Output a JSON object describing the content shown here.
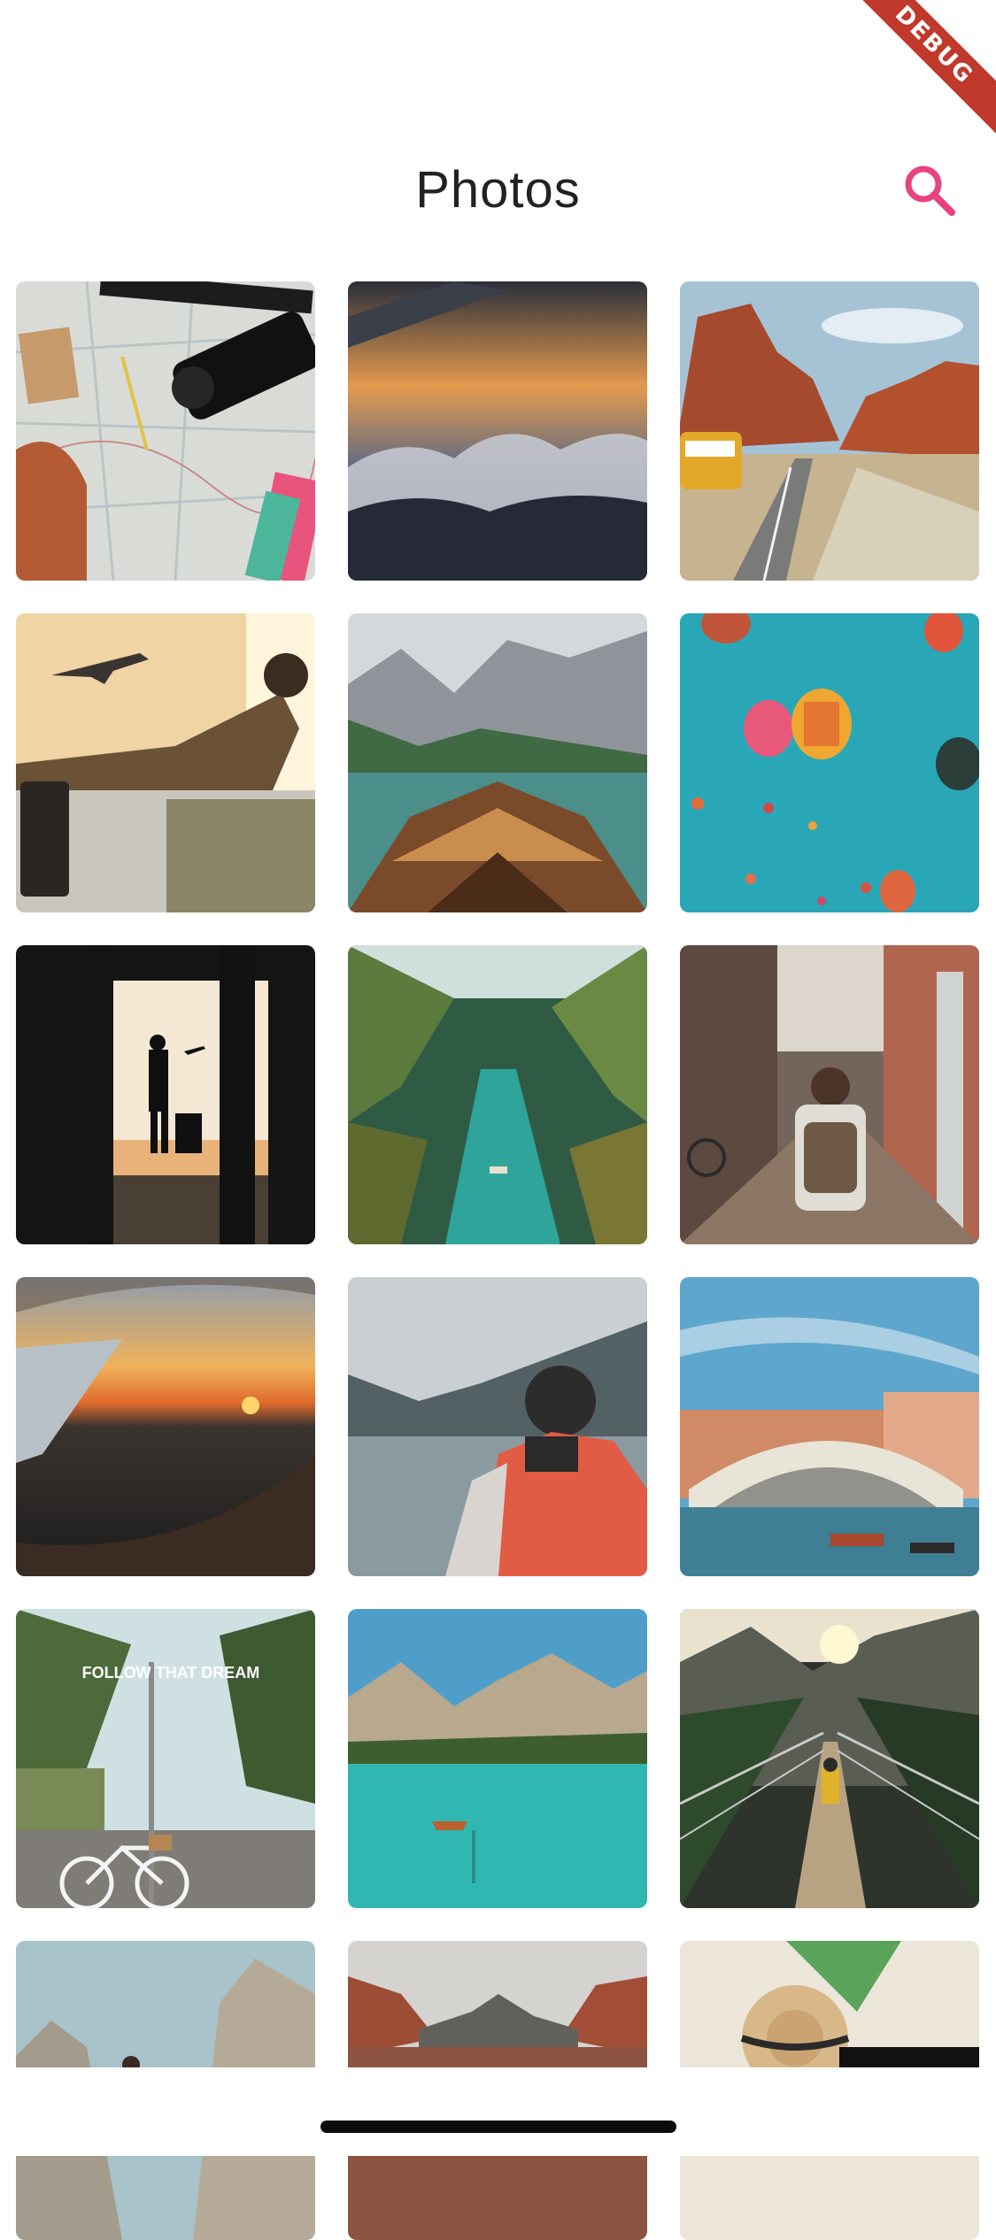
{
  "debug_banner": {
    "label": "DEBUG"
  },
  "header": {
    "title": "Photos",
    "search_icon": "search-icon",
    "accent_color": "#e8437f"
  },
  "photos": [
    {
      "subject": "map-camera-notes",
      "bg": "#d9dcd6"
    },
    {
      "subject": "airplane-wing-sunset-clouds",
      "bg": "#2a2f3c"
    },
    {
      "subject": "red-rocks-yellow-van",
      "bg": "#a6c3d6"
    },
    {
      "subject": "airport-traveler-plane",
      "bg": "#e0b97a"
    },
    {
      "subject": "boat-mountain-lake",
      "bg": "#8e9aa0"
    },
    {
      "subject": "hot-air-balloons",
      "bg": "#2aa7b7"
    },
    {
      "subject": "airport-silhouette",
      "bg": "#1a1a1a"
    },
    {
      "subject": "palm-river",
      "bg": "#3d6b54"
    },
    {
      "subject": "backpacker-alley",
      "bg": "#7a6559"
    },
    {
      "subject": "window-sunset-wing",
      "bg": "#3a2e26"
    },
    {
      "subject": "hiker-lake-mountains",
      "bg": "#a7b2b5"
    },
    {
      "subject": "venice-rialto",
      "bg": "#5fa6cc"
    },
    {
      "subject": "follow-that-dream-bike",
      "bg": "#7b8a6c"
    },
    {
      "subject": "turquoise-lake-canoe",
      "bg": "#3bb2ad"
    },
    {
      "subject": "suspension-bridge",
      "bg": "#3a3c36"
    },
    {
      "subject": "rocky-peaks",
      "bg": "#a8c3c9"
    },
    {
      "subject": "red-canyon",
      "bg": "#9c6a5a"
    },
    {
      "subject": "hat-and-leaf",
      "bg": "#ece6da"
    }
  ],
  "street_sign": "FOLLOW THAT DREAM"
}
